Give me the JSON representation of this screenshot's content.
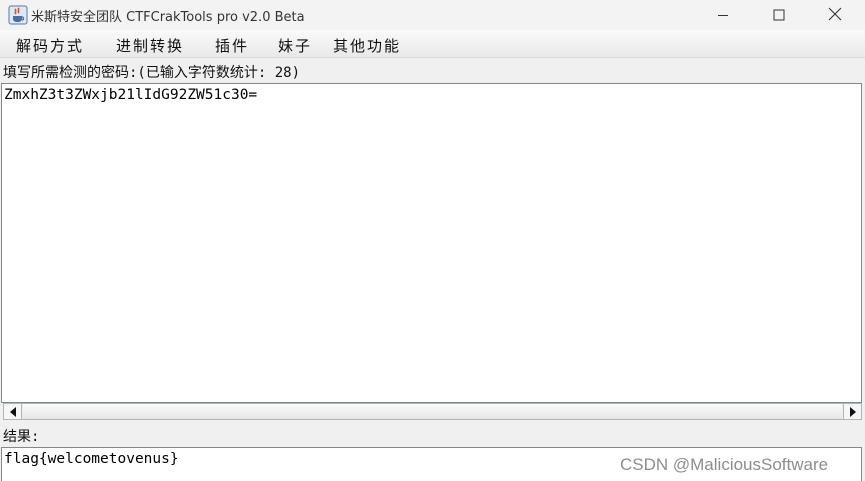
{
  "window": {
    "title": "米斯特安全团队 CTFCrakTools pro v2.0 Beta",
    "icon": "java-app-icon"
  },
  "menu": {
    "items": [
      {
        "label": "解码方式"
      },
      {
        "label": "进制转换"
      },
      {
        "label": "插件"
      },
      {
        "label": "妹子"
      },
      {
        "label": "其他功能"
      }
    ]
  },
  "input": {
    "label": "填写所需检测的密码:(已输入字符数统计: 28)",
    "value": "ZmxhZ3t3ZWxjb21lIdG92ZW51c30="
  },
  "result": {
    "label": "结果:",
    "value": "flag{welcometovenus}"
  },
  "watermark": "CSDN @MaliciousSoftware",
  "colors": {
    "border": "#7a8a99",
    "background": "#f0f0f0",
    "watermark": "#8d8d8d"
  }
}
